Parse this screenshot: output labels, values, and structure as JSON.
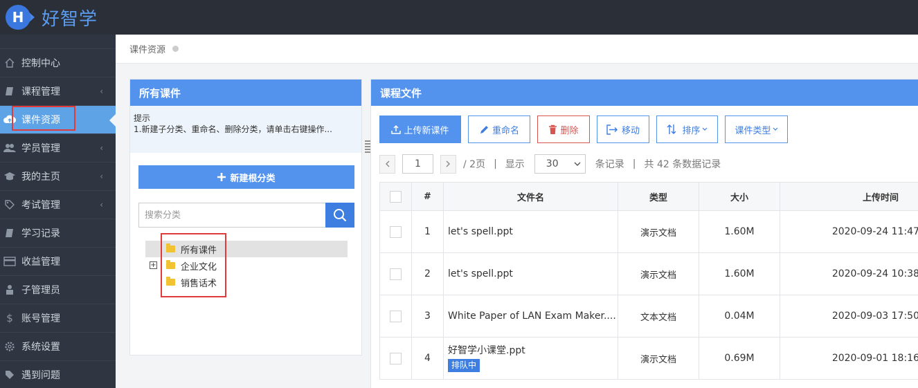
{
  "app": {
    "logo_letter": "H",
    "name": "好智学"
  },
  "sidebar": {
    "items": [
      {
        "label": "控制中心",
        "icon": "home-icon",
        "has_caret": false
      },
      {
        "label": "课程管理",
        "icon": "book-icon",
        "has_caret": true
      },
      {
        "label": "课件资源",
        "icon": "cloud-upload-icon",
        "has_caret": false,
        "active": true
      },
      {
        "label": "学员管理",
        "icon": "users-icon",
        "has_caret": true
      },
      {
        "label": "我的主页",
        "icon": "graduation-cap-icon",
        "has_caret": true
      },
      {
        "label": "考试管理",
        "icon": "tag-icon",
        "has_caret": true
      },
      {
        "label": "学习记录",
        "icon": "book-icon",
        "has_caret": false
      },
      {
        "label": "收益管理",
        "icon": "credit-card-icon",
        "has_caret": false
      },
      {
        "label": "子管理员",
        "icon": "user-lock-icon",
        "has_caret": false
      },
      {
        "label": "账号管理",
        "icon": "dollar-icon",
        "has_caret": false
      },
      {
        "label": "系统设置",
        "icon": "gear-icon",
        "has_caret": false
      },
      {
        "label": "遇到问题",
        "icon": "tag-icon",
        "has_caret": false
      }
    ],
    "caret": "‹"
  },
  "breadcrumb": {
    "current": "课件资源"
  },
  "left_panel": {
    "title": "所有课件",
    "tip_title": "提示",
    "tip_text": "1.新建子分类、重命名、删除分类，请单击右键操作...",
    "new_root_button": "新建根分类",
    "search_placeholder": "搜索分类",
    "tree": [
      {
        "label": "所有课件",
        "selected": true
      },
      {
        "label": "企业文化",
        "expandable": true
      },
      {
        "label": "销售话术"
      }
    ],
    "expander_symbol": "+"
  },
  "right_panel": {
    "title": "课程文件",
    "toolbar": {
      "upload": "上传新课件",
      "rename": "重命名",
      "delete": "删除",
      "move": "移动",
      "sort": "排序",
      "file_type": "课件类型"
    },
    "pager": {
      "current_page": "1",
      "total_pages_text": "/ 2页",
      "show_text": "显示",
      "page_size": "30",
      "records_text": "条记录",
      "total_text": "共 42 条数据记录",
      "separator": "|"
    },
    "table": {
      "columns": {
        "num": "#",
        "name": "文件名",
        "type": "类型",
        "size": "大小",
        "time": "上传时间"
      },
      "rows": [
        {
          "num": "1",
          "name": "let's spell.ppt",
          "type": "演示文档",
          "size": "1.60M",
          "time": "2020-09-24 11:47",
          "badge": ""
        },
        {
          "num": "2",
          "name": "let's spell.ppt",
          "type": "演示文档",
          "size": "1.60M",
          "time": "2020-09-24 10:38",
          "badge": ""
        },
        {
          "num": "3",
          "name": "White Paper of LAN Exam Maker....",
          "type": "文本文档",
          "size": "0.04M",
          "time": "2020-09-03 17:50",
          "badge": ""
        },
        {
          "num": "4",
          "name": "好智学小课堂.ppt",
          "type": "演示文档",
          "size": "0.69M",
          "time": "2020-09-01 18:16",
          "badge": "排队中"
        }
      ]
    }
  },
  "colors": {
    "primary": "#5393ee",
    "sidebar_bg": "#2f3641",
    "topbar_bg": "#2a2f38",
    "active_nav": "#5da3e6",
    "danger": "#d9534f",
    "highlight_frame": "#e03a3a"
  }
}
